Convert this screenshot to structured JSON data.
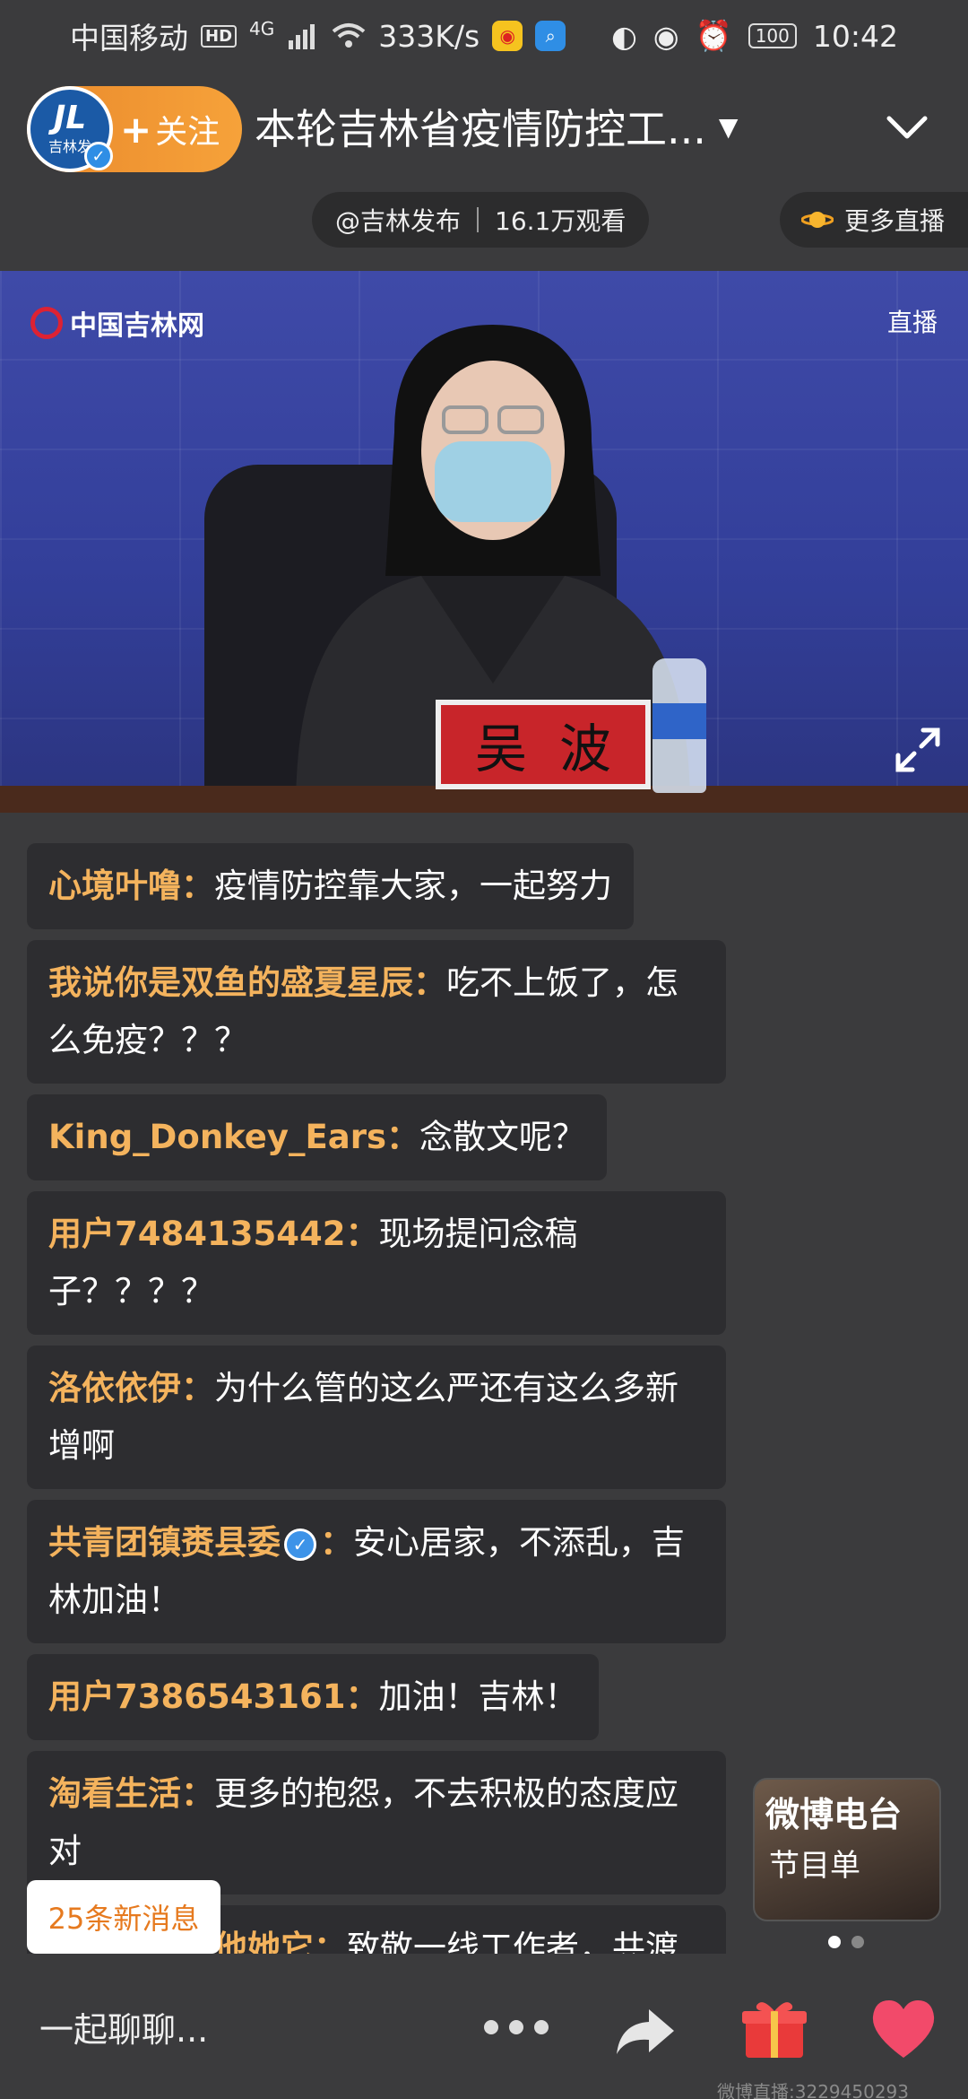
{
  "status_bar": {
    "carrier": "中国移动",
    "hd": "HD",
    "network": "4G",
    "speed": "333K/s",
    "battery": "100",
    "time": "10:42"
  },
  "header": {
    "avatar_text": "吉林发",
    "follow_label": "关注",
    "title": "本轮吉林省疫情防控工...",
    "channel": "@吉林发布",
    "viewers": "16.1万观看",
    "more_live": "更多直播"
  },
  "video": {
    "source_logo": "中国吉林网",
    "live_label": "直播",
    "nameplate": "吴波"
  },
  "comments": [
    {
      "user": "心境叶噜：",
      "text": "疫情防控靠大家，一起努力",
      "verified": false
    },
    {
      "user": "我说你是双鱼的盛夏星辰：",
      "text": "吃不上饭了，怎么免疫？？？",
      "verified": false
    },
    {
      "user": "King_Donkey_Ears：",
      "text": "念散文呢？",
      "verified": false
    },
    {
      "user": "用户7484135442：",
      "text": "现场提问念稿子？？？？",
      "verified": false
    },
    {
      "user": "洛依依伊：",
      "text": "为什么管的这么严还有这么多新增啊",
      "verified": false
    },
    {
      "user": "共青团镇赉县委",
      "text": "安心居家，不添乱，吉林加油！",
      "verified": true
    },
    {
      "user": "用户7386543161：",
      "text": "加油！吉林！",
      "verified": false
    },
    {
      "user": "淘看生活：",
      "text": "更多的抱怨，不去积极的态度应对",
      "verified": false
    },
    {
      "user": "曾经的你我他她它：",
      "text": "致敬一线工作者，共渡难关，吉林加油！",
      "verified": false
    }
  ],
  "new_messages": "25条新消息",
  "radio_card": {
    "title": "微博电台",
    "subtitle": "节目单"
  },
  "bottom_bar": {
    "chat_placeholder": "一起聊聊...",
    "watermark": "微博直播:3229450293"
  },
  "colors": {
    "background": "#3b3b3d",
    "username": "#f4b35d",
    "follow_gradient_start": "#ea8a2c",
    "follow_gradient_end": "#f6a23a",
    "new_message_text": "#e67a1f"
  },
  "icons": [
    "hd-icon",
    "signal-icon",
    "wifi-icon",
    "weibo-app-icon",
    "search-app-icon",
    "nfc-icon",
    "eye-icon",
    "alarm-icon",
    "battery-icon",
    "verified-icon",
    "chevron-down-icon",
    "collapse-icon",
    "planet-icon",
    "fullscreen-icon",
    "more-icon",
    "share-icon",
    "gift-icon",
    "heart-icon"
  ]
}
